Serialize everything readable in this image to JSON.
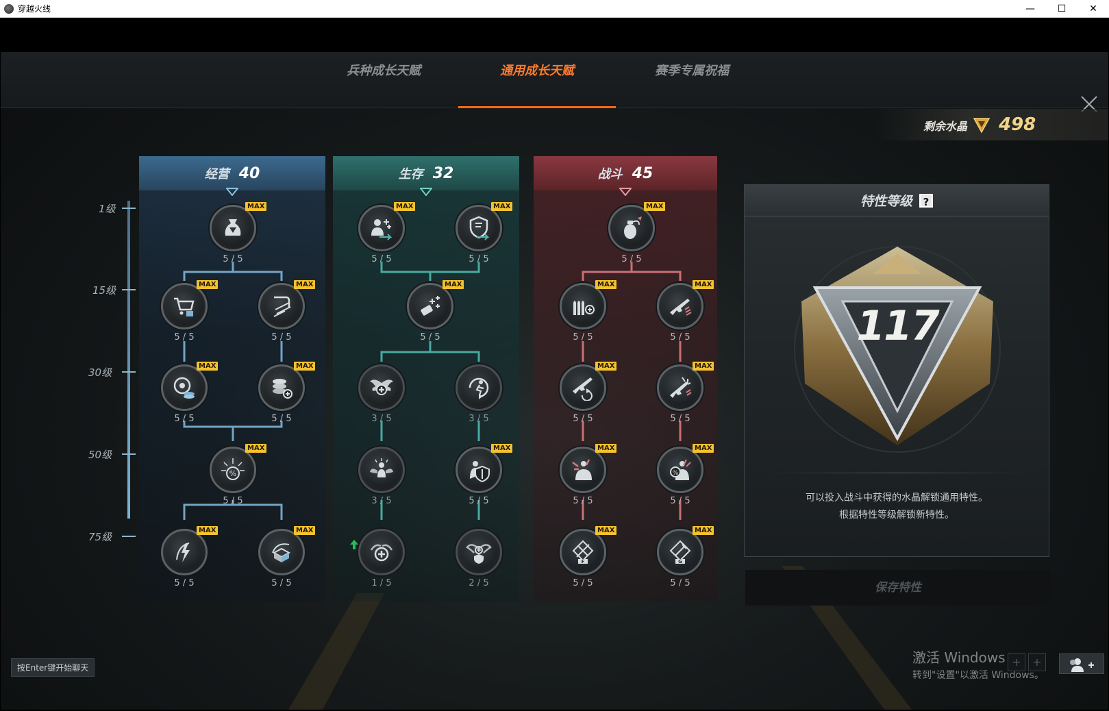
{
  "window": {
    "title": "穿越火线",
    "minimize": "—",
    "maximize": "☐",
    "close": "✕"
  },
  "tabs": [
    {
      "label": "兵种成长天赋",
      "active": false
    },
    {
      "label": "通用成长天赋",
      "active": true
    },
    {
      "label": "赛季专属祝福",
      "active": false
    }
  ],
  "crystal": {
    "label": "剩余水晶",
    "value": "498"
  },
  "levels": [
    "1级",
    "15级",
    "30级",
    "50级",
    "75级"
  ],
  "columns": [
    {
      "name": "经营",
      "points": "40",
      "color": "#7db3d6"
    },
    {
      "name": "生存",
      "points": "32",
      "color": "#4fb8ad"
    },
    {
      "name": "战斗",
      "points": "45",
      "color": "#d9797f"
    }
  ],
  "max_badge": "MAX",
  "skills": {
    "economy": [
      {
        "id": "money-bag",
        "level": "5 / 5",
        "max": true
      },
      {
        "id": "cart",
        "level": "5 / 5",
        "max": true
      },
      {
        "id": "scroll",
        "level": "5 / 5",
        "max": true
      },
      {
        "id": "coin-refresh",
        "level": "5 / 5",
        "max": true
      },
      {
        "id": "coin-stack-plus",
        "level": "5 / 5",
        "max": true
      },
      {
        "id": "percent-burst",
        "level": "5 / 5",
        "max": true
      },
      {
        "id": "lightning-star",
        "level": "5 / 5",
        "max": true
      },
      {
        "id": "crate",
        "level": "5 / 5",
        "max": true
      }
    ],
    "survival": [
      {
        "id": "person-plus",
        "level": "5 / 5",
        "max": true
      },
      {
        "id": "shield-arrow",
        "level": "5 / 5",
        "max": true
      },
      {
        "id": "flashlight-plus",
        "level": "5 / 5",
        "max": true
      },
      {
        "id": "winged-medic",
        "level": "3 / 5",
        "max": false
      },
      {
        "id": "runner-refresh",
        "level": "3 / 5",
        "max": false
      },
      {
        "id": "angel-figure",
        "level": "3 / 5",
        "max": false
      },
      {
        "id": "shield-figure",
        "level": "5 / 5",
        "max": true
      },
      {
        "id": "heal-loop",
        "level": "1 / 5",
        "max": false
      },
      {
        "id": "wing-shield",
        "level": "2 / 5",
        "max": false
      }
    ],
    "combat": [
      {
        "id": "grenade",
        "level": "5 / 5",
        "max": true
      },
      {
        "id": "ammo-plus",
        "level": "5 / 5",
        "max": true
      },
      {
        "id": "rifle-up",
        "level": "5 / 5",
        "max": true
      },
      {
        "id": "rifle-reload",
        "level": "5 / 5",
        "max": true
      },
      {
        "id": "rifle-burst",
        "level": "5 / 5",
        "max": true
      },
      {
        "id": "target-shatter",
        "level": "5 / 5",
        "max": true
      },
      {
        "id": "crit-percent",
        "level": "5 / 5",
        "max": true
      },
      {
        "id": "badge-f",
        "level": "5 / 5",
        "max": true
      },
      {
        "id": "badge-g",
        "level": "5 / 5",
        "max": true
      }
    ]
  },
  "panel": {
    "title": "特性等级",
    "help": "?",
    "level": "117",
    "desc1": "可以投入战斗中获得的水晶解锁通用特性。",
    "desc2": "根据特性等级解锁新特性。",
    "save": "保存特性"
  },
  "chat_hint": "按Enter键开始聊天",
  "activation": {
    "line1": "激活 Windows",
    "line2": "转到\"设置\"以激活 Windows。"
  },
  "slots": [
    "+",
    "+",
    "+"
  ]
}
